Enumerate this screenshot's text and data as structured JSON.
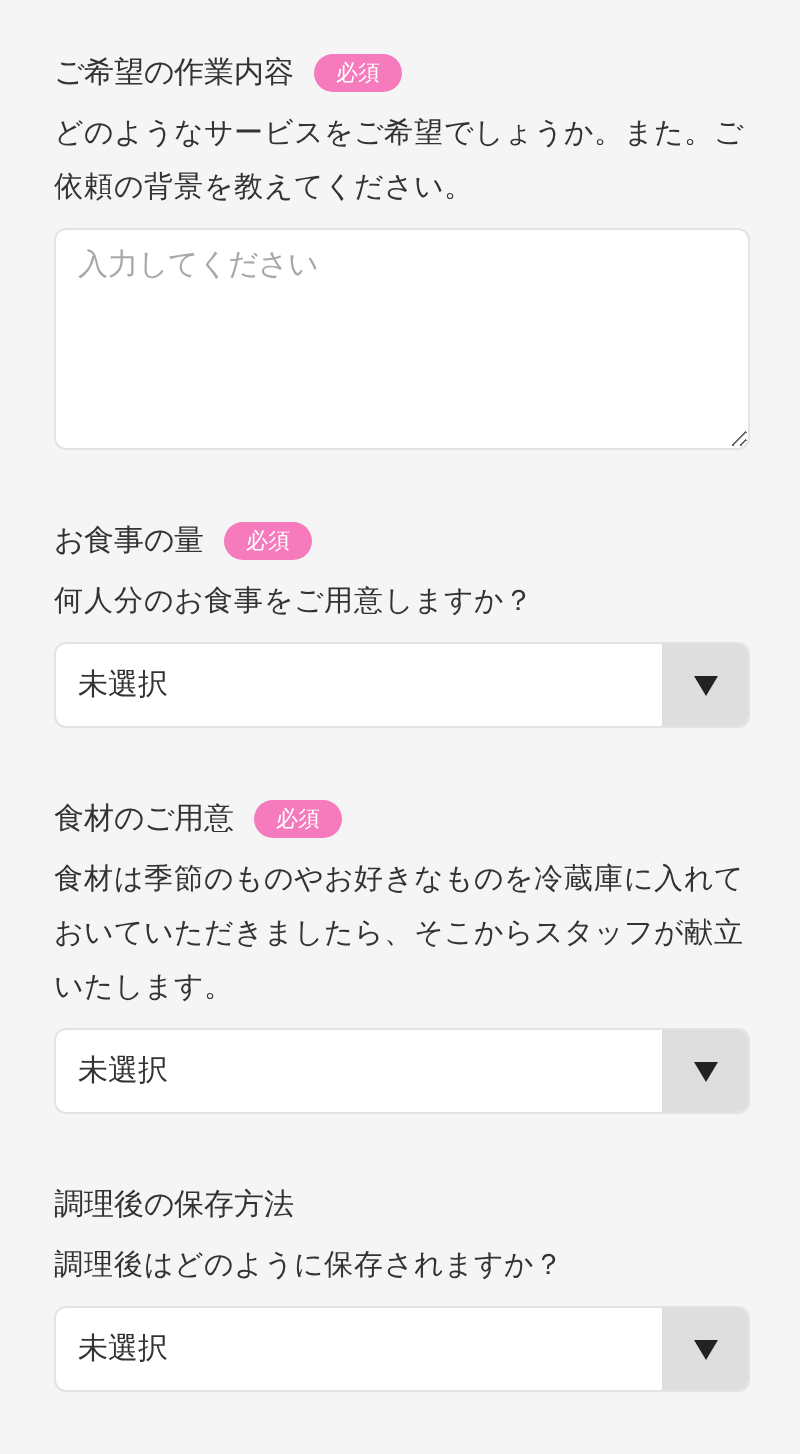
{
  "sections": [
    {
      "title": "ご希望の作業内容",
      "required": true,
      "required_badge": "必須",
      "description": "どのようなサービスをご希望でしょうか。また。ご依頼の背景を教えてください。",
      "field": {
        "kind": "textarea",
        "placeholder": "入力してください"
      }
    },
    {
      "title": "お食事の量",
      "required": true,
      "required_badge": "必須",
      "description": "何人分のお食事をご用意しますか？",
      "field": {
        "kind": "select",
        "value": "未選択"
      }
    },
    {
      "title": "食材のご用意",
      "required": true,
      "required_badge": "必須",
      "description": "食材は季節のものやお好きなものを冷蔵庫に入れておいていただきましたら、そこからスタッフが献立いたします。",
      "field": {
        "kind": "select",
        "value": "未選択"
      }
    },
    {
      "title": "調理後の保存方法",
      "required": false,
      "description": "調理後はどのように保存されますか？",
      "field": {
        "kind": "select",
        "value": "未選択"
      }
    }
  ]
}
